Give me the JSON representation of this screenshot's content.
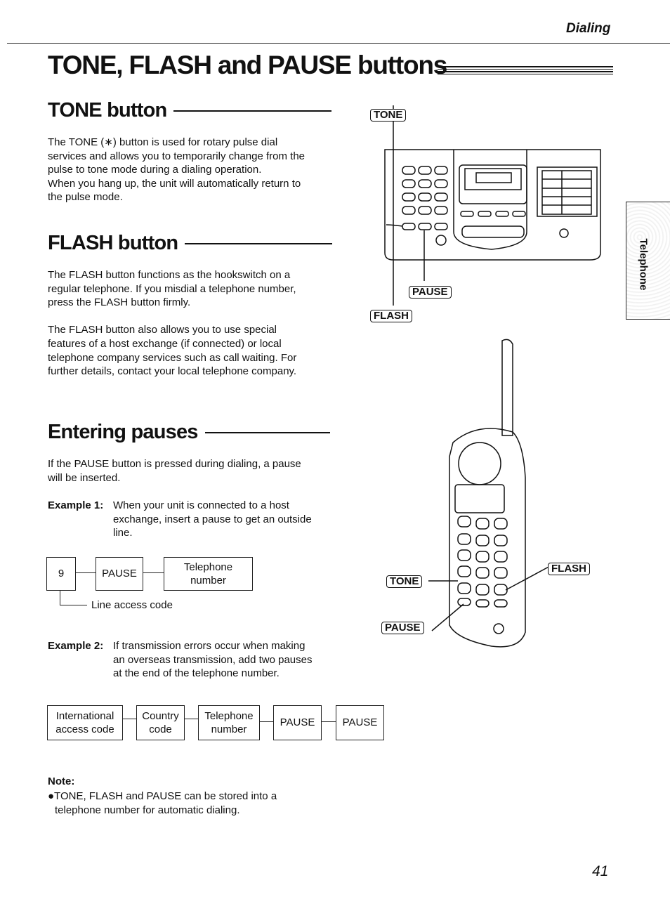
{
  "header": {
    "section": "Dialing"
  },
  "title": "TONE, FLASH and PAUSE buttons",
  "tone": {
    "heading": "TONE button",
    "lines": [
      "The TONE (∗) button is used for rotary pulse dial",
      "services and allows you to temporarily change from the",
      "pulse to tone mode during a dialing operation.",
      "When you hang up, the unit will automatically return to",
      "the pulse mode."
    ]
  },
  "flash": {
    "heading": "FLASH button",
    "para1": [
      "The FLASH button functions as the hookswitch on a",
      "regular telephone. If you misdial a telephone number,",
      "press the FLASH button firmly."
    ],
    "para2": [
      "The FLASH button also allows you to use special",
      "features of a host exchange (if connected) or local",
      "telephone company services such as call waiting. For",
      "further details, contact your local telephone company."
    ]
  },
  "pauses": {
    "heading": "Entering pauses",
    "intro": [
      "If the PAUSE button is pressed during dialing, a pause",
      "will be inserted."
    ],
    "example1": {
      "label": "Example 1:",
      "lines": [
        "When your unit is connected to a host",
        "exchange, insert a pause to get an outside",
        "line."
      ]
    },
    "diagram1": {
      "boxes": [
        "9",
        "PAUSE",
        "Telephone number"
      ],
      "annotation": "Line access code"
    },
    "example2": {
      "label": "Example 2:",
      "lines": [
        "If transmission errors occur when making",
        "an overseas transmission, add two pauses",
        "at the end of the telephone number."
      ]
    },
    "diagram2": {
      "boxes": [
        "International access code",
        "Country code",
        "Telephone number",
        "PAUSE",
        "PAUSE"
      ]
    }
  },
  "note": {
    "label": "Note:",
    "lines": [
      "●TONE, FLASH and PAUSE can be stored into a",
      "telephone number for automatic dialing."
    ]
  },
  "fax_labels": {
    "tone": "TONE",
    "pause": "PAUSE",
    "flash": "FLASH"
  },
  "handset_labels": {
    "tone": "TONE",
    "pause": "PAUSE",
    "flash": "FLASH"
  },
  "side_tab": "Telephone",
  "page_number": "41"
}
